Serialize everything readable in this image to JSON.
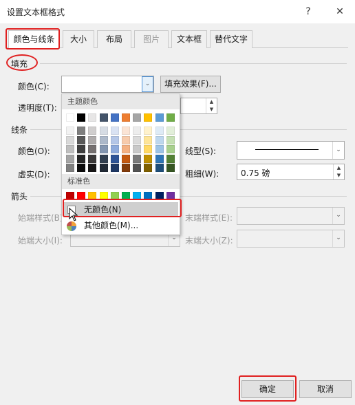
{
  "window": {
    "title": "设置文本框格式",
    "help": "?",
    "close": "✕"
  },
  "tabs": [
    {
      "label": "颜色与线条"
    },
    {
      "label": "大小"
    },
    {
      "label": "布局"
    },
    {
      "label": "图片"
    },
    {
      "label": "文本框"
    },
    {
      "label": "替代文字"
    }
  ],
  "fill": {
    "section": "填充",
    "color_label": "颜色(C):",
    "color_value": "",
    "fill_effects": "填充效果(F)...",
    "transparency_label": "透明度(T):"
  },
  "line": {
    "section": "线条",
    "color_label": "颜色(O):",
    "dashed_label": "虚实(D):",
    "style_label": "线型(S):",
    "weight_label": "粗细(W):",
    "weight_value": "0.75 磅"
  },
  "arrows": {
    "section": "箭头",
    "begin_style": "始端样式(B):",
    "begin_size": "始端大小(I):",
    "end_style": "末端样式(E):",
    "end_size": "末端大小(Z):"
  },
  "palette": {
    "theme_header": "主题颜色",
    "standard_header": "标准色",
    "no_color": "无颜色(N)",
    "more_colors": "其他颜色(M)...",
    "theme_top": [
      "#ffffff",
      "#000000",
      "#e7e6e6",
      "#44546a",
      "#4472c4",
      "#ed7d31",
      "#a5a5a5",
      "#ffc000",
      "#5b9bd5",
      "#70ad47"
    ],
    "theme_shades": [
      [
        "#f2f2f2",
        "#7f7f7f",
        "#d0cece",
        "#d6dce4",
        "#d9e2f3",
        "#fbe4d5",
        "#ededed",
        "#fff2cc",
        "#deebf6",
        "#e2efd9"
      ],
      [
        "#d9d9d9",
        "#595959",
        "#aeabab",
        "#adb9ca",
        "#b4c6e7",
        "#f7cbac",
        "#dbdbdb",
        "#fee599",
        "#bdd7ee",
        "#c5e0b3"
      ],
      [
        "#bfbfbf",
        "#3f3f3f",
        "#757070",
        "#8496b0",
        "#8eaadb",
        "#f4b183",
        "#c9c9c9",
        "#ffd965",
        "#9cc3e5",
        "#a8d08d"
      ],
      [
        "#a5a5a5",
        "#262626",
        "#3a3838",
        "#323f4f",
        "#2f5496",
        "#c55a11",
        "#7b7b7b",
        "#bf9000",
        "#2e75b5",
        "#538135"
      ],
      [
        "#7f7f7f",
        "#0c0c0c",
        "#171616",
        "#222a35",
        "#1f3864",
        "#833c0b",
        "#525252",
        "#7f6000",
        "#1e4e79",
        "#375623"
      ]
    ],
    "standard": [
      "#c00000",
      "#ff0000",
      "#ffc000",
      "#ffff00",
      "#92d050",
      "#00b050",
      "#00b0f0",
      "#0070c0",
      "#002060",
      "#7030a0"
    ]
  },
  "buttons": {
    "ok": "确定",
    "cancel": "取消"
  }
}
